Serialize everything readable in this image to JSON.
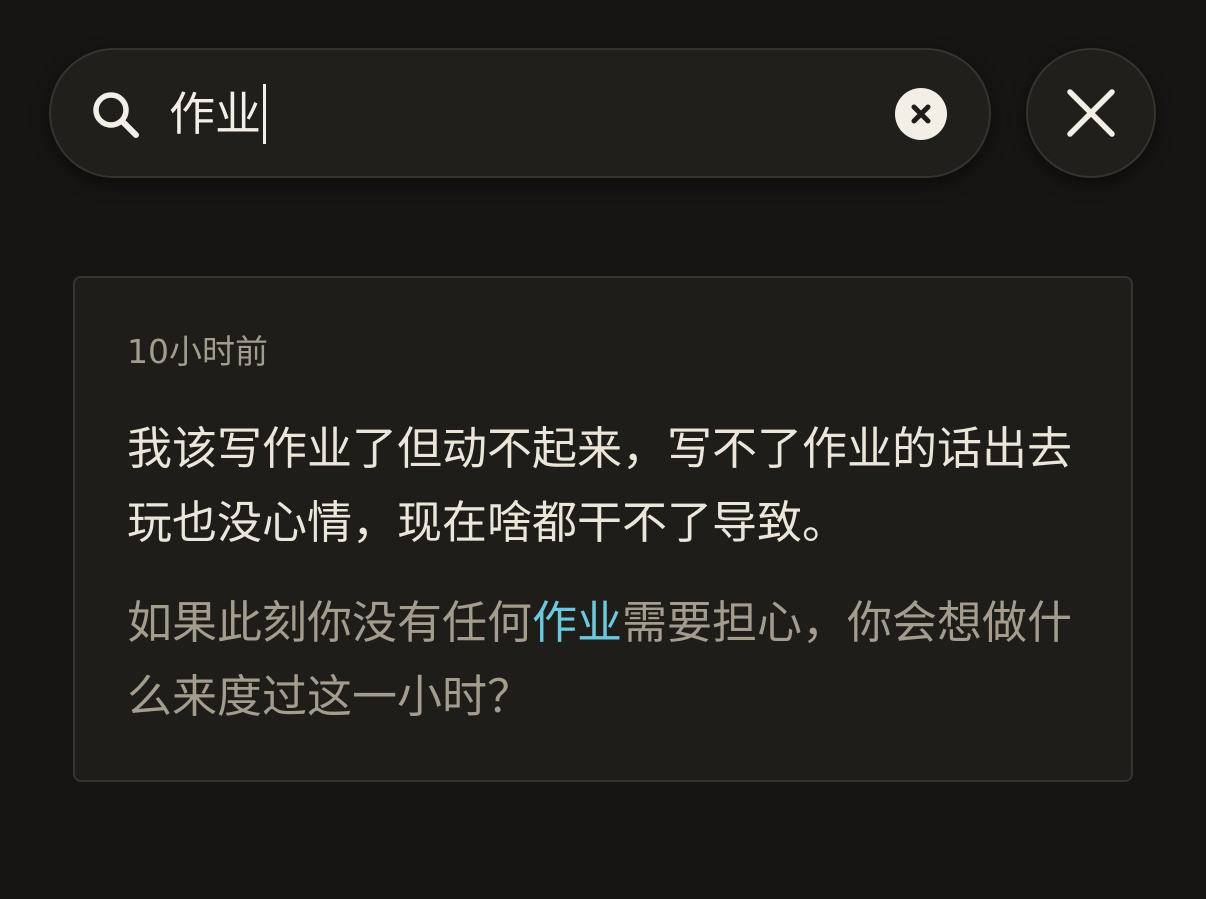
{
  "search": {
    "query": "作业",
    "icon": "search-icon",
    "clear_icon": "clear-circle-icon"
  },
  "close": {
    "icon": "close-icon"
  },
  "result": {
    "timestamp": "10小时前",
    "entry_text": "我该写作业了但动不起来，写不了作业的话出去玩也没心情，现在啥都干不了导致。",
    "prompt_before": "如果此刻你没有任何",
    "prompt_highlight": "作业",
    "prompt_after": "需要担心，你会想做什么来度过这一小时？"
  },
  "colors": {
    "background": "#161513",
    "surface": "#201f1b",
    "text_primary": "#ece6da",
    "text_secondary": "#a49c8d",
    "highlight": "#6cc8dd"
  }
}
